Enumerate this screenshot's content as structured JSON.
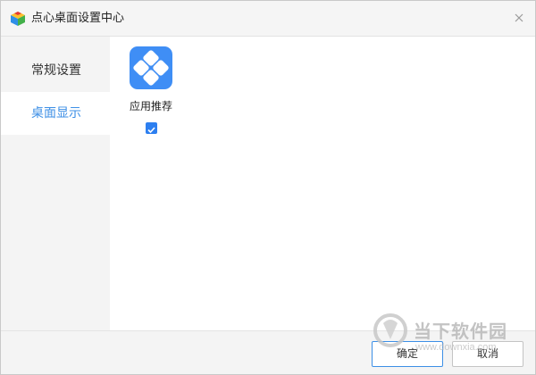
{
  "window": {
    "title": "点心桌面设置中心",
    "app_icon": "colorful-cube-icon",
    "close_icon": "close-icon"
  },
  "sidebar": {
    "items": [
      {
        "label": "常规设置",
        "active": false
      },
      {
        "label": "桌面显示",
        "active": true
      }
    ]
  },
  "content": {
    "apps": [
      {
        "label": "应用推荐",
        "icon": "app-diamond-icon",
        "checked": true
      }
    ]
  },
  "footer": {
    "ok_label": "确定",
    "cancel_label": "取消"
  },
  "watermark": {
    "text": "当下软件园",
    "url": "www.downxia.com"
  },
  "colors": {
    "accent": "#3d8fe6",
    "tile": "#3f8ef5",
    "sidebar_bg": "#f4f4f4",
    "titlebar_bg": "#f5f5f5"
  }
}
